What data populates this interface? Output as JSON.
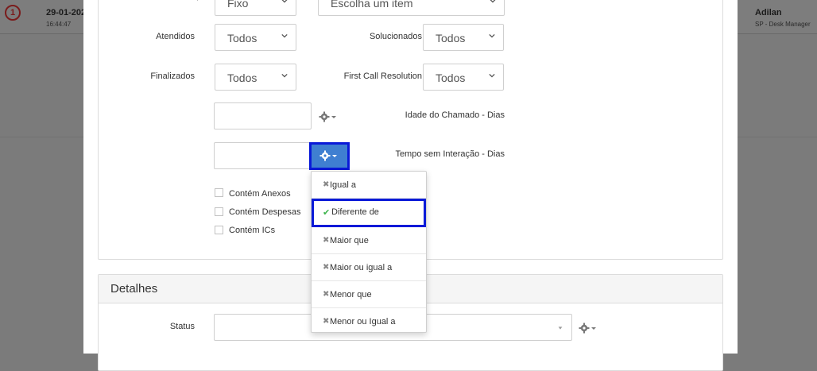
{
  "background_row": {
    "date": "29-01-202",
    "time": "16:44:47",
    "user": "Adilan",
    "role": "SP - Desk Manager"
  },
  "filters": {
    "row0": {
      "left_value": "Fixo",
      "right_placeholder": "Escolha um item"
    },
    "atendidos": {
      "label": "Atendidos",
      "value": "Todos"
    },
    "solucionados": {
      "label": "Solucionados",
      "value": "Todos"
    },
    "finalizados": {
      "label": "Finalizados",
      "value": "Todos"
    },
    "fcr": {
      "label": "First Call Resolution",
      "value": "Todos"
    },
    "idade": {
      "label": "Idade do Chamado - Dias"
    },
    "tempo": {
      "label": "Tempo sem Interação - Dias"
    },
    "checkboxes": [
      "Contém Anexos",
      "Contém Despesas",
      "Contém ICs"
    ]
  },
  "dropdown": {
    "items": [
      {
        "icon": "x-icon",
        "label": "Igual a"
      },
      {
        "icon": "check-icon",
        "label": "Diferente de",
        "selected": true
      },
      {
        "icon": "x-icon",
        "label": "Maior que"
      },
      {
        "icon": "x-icon",
        "label": "Maior ou igual a"
      },
      {
        "icon": "x-icon",
        "label": "Menor que"
      },
      {
        "icon": "x-icon",
        "label": "Menor ou Igual a"
      }
    ]
  },
  "detalhes": {
    "title": "Detalhes",
    "status_label": "Status"
  },
  "colors": {
    "accent_blue": "#3f7fd1",
    "highlight_outline": "#0a1ad8",
    "check_green": "#3cb44b"
  }
}
